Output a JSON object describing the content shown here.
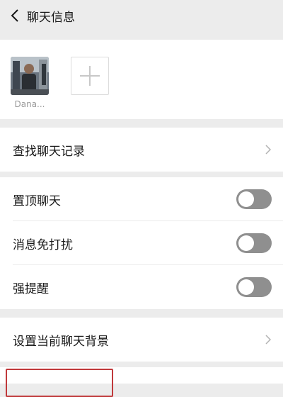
{
  "header": {
    "title": "聊天信息",
    "back_icon": "chevron-left-icon"
  },
  "members": {
    "items": [
      {
        "name": "Dana..."
      }
    ],
    "add_icon": "plus-icon"
  },
  "search_row": {
    "label": "查找聊天记录"
  },
  "toggles": [
    {
      "label": "置顶聊天",
      "on": false
    },
    {
      "label": "消息免打扰",
      "on": false
    },
    {
      "label": "强提醒",
      "on": false
    }
  ],
  "background_row": {
    "label": "设置当前聊天背景"
  },
  "colors": {
    "background": "#ececec",
    "card": "#ffffff",
    "toggle_off": "#8f8f8f",
    "highlight": "#c0393b"
  }
}
